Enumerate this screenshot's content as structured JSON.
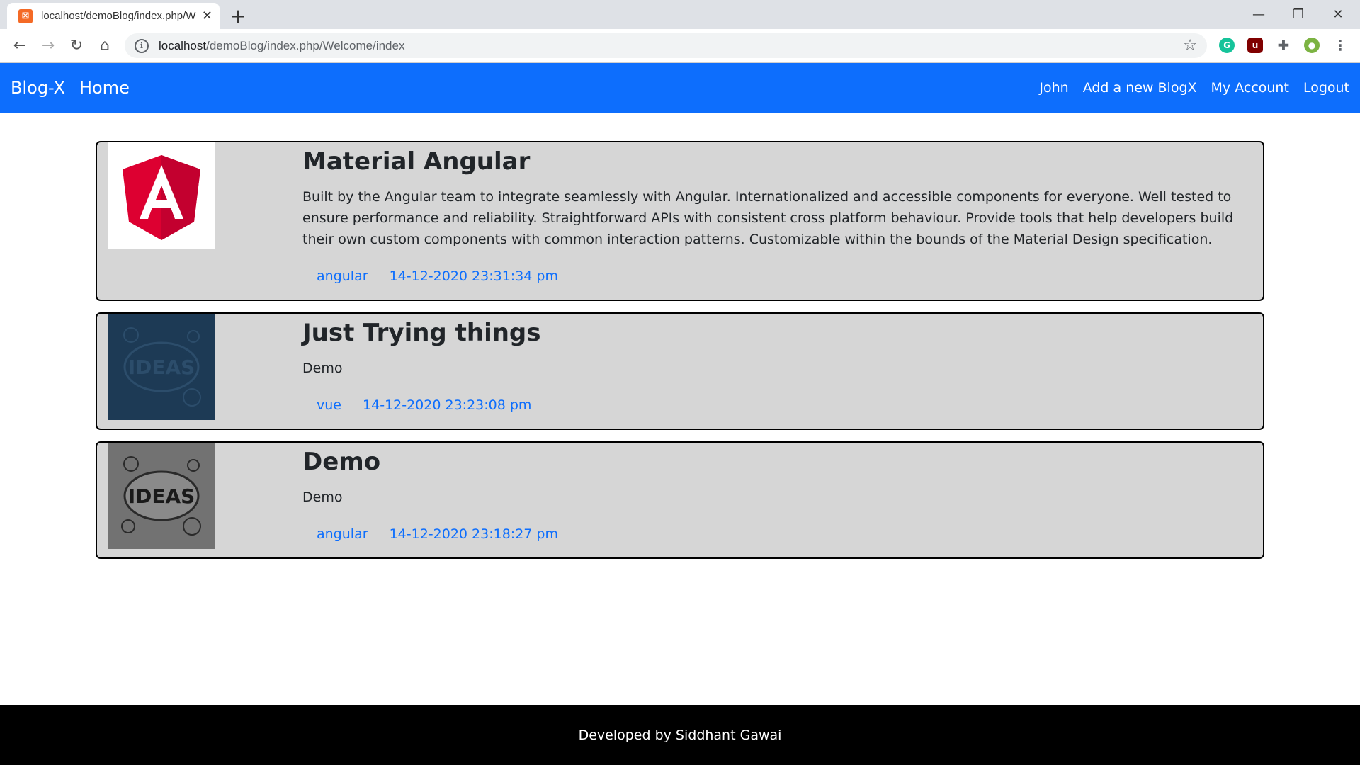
{
  "browser": {
    "tab_title": "localhost/demoBlog/index.php/W",
    "url_host": "localhost",
    "url_path": "/demoBlog/index.php/Welcome/index"
  },
  "navbar": {
    "brand": "Blog-X",
    "home": "Home",
    "user": "John",
    "add": "Add a new BlogX",
    "account": "My Account",
    "logout": "Logout"
  },
  "posts": [
    {
      "title": "Material Angular",
      "description": "Built by the Angular team to integrate seamlessly with Angular. Internationalized and accessible components for everyone. Well tested to ensure performance and reliability. Straightforward APIs with consistent cross platform behaviour. Provide tools that help developers build their own custom components with common interaction patterns. Customizable within the bounds of the Material Design specification.",
      "tag": "angular",
      "date": "14-12-2020 23:31:34 pm",
      "image": "angular-logo"
    },
    {
      "title": "Just Trying things",
      "description": "Demo",
      "tag": "vue",
      "date": "14-12-2020 23:23:08 pm",
      "image": "ideas-sketch-blue"
    },
    {
      "title": "Demo",
      "description": "Demo",
      "tag": "angular",
      "date": "14-12-2020 23:18:27 pm",
      "image": "ideas-sketch-grey"
    }
  ],
  "footer": {
    "text": "Developed by Siddhant Gawai"
  }
}
